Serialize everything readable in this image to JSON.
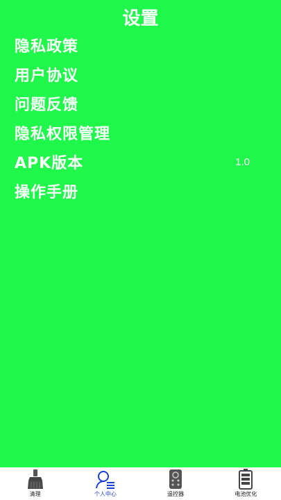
{
  "header": {
    "title": "设置"
  },
  "menu": {
    "items": [
      {
        "label": "隐私政策"
      },
      {
        "label": "用户协议"
      },
      {
        "label": "问题反馈"
      },
      {
        "label": "隐私权限管理"
      },
      {
        "label": "APK版本",
        "value": "1.0"
      },
      {
        "label": "操作手册"
      }
    ]
  },
  "tabbar": {
    "tabs": [
      {
        "label": "清理",
        "icon": "broom-icon"
      },
      {
        "label": "个人中心",
        "icon": "profile-icon",
        "active": true
      },
      {
        "label": "遥控器",
        "icon": "remote-icon"
      },
      {
        "label": "电池优化",
        "icon": "battery-icon"
      }
    ],
    "active_color": "#1a3fd6"
  },
  "colors": {
    "background": "#1ff84a",
    "text": "#ffffff"
  }
}
